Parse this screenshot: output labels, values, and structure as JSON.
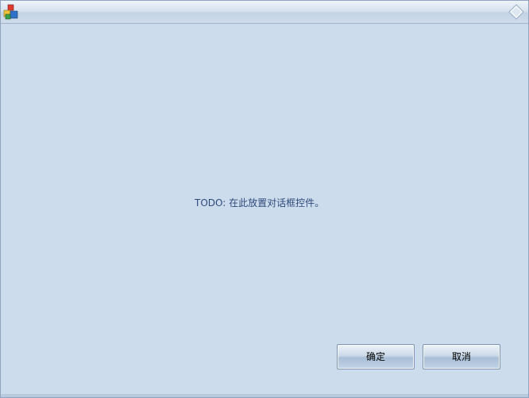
{
  "window": {
    "title": "",
    "title_icon": "app-cube-icon",
    "title_button_icon": "diamond-icon"
  },
  "content": {
    "todo_text": "TODO: 在此放置对话框控件。"
  },
  "buttons": {
    "ok_label": "确定",
    "cancel_label": "取消"
  },
  "colors": {
    "background": "#cddcec",
    "text": "#2d4a7a"
  }
}
